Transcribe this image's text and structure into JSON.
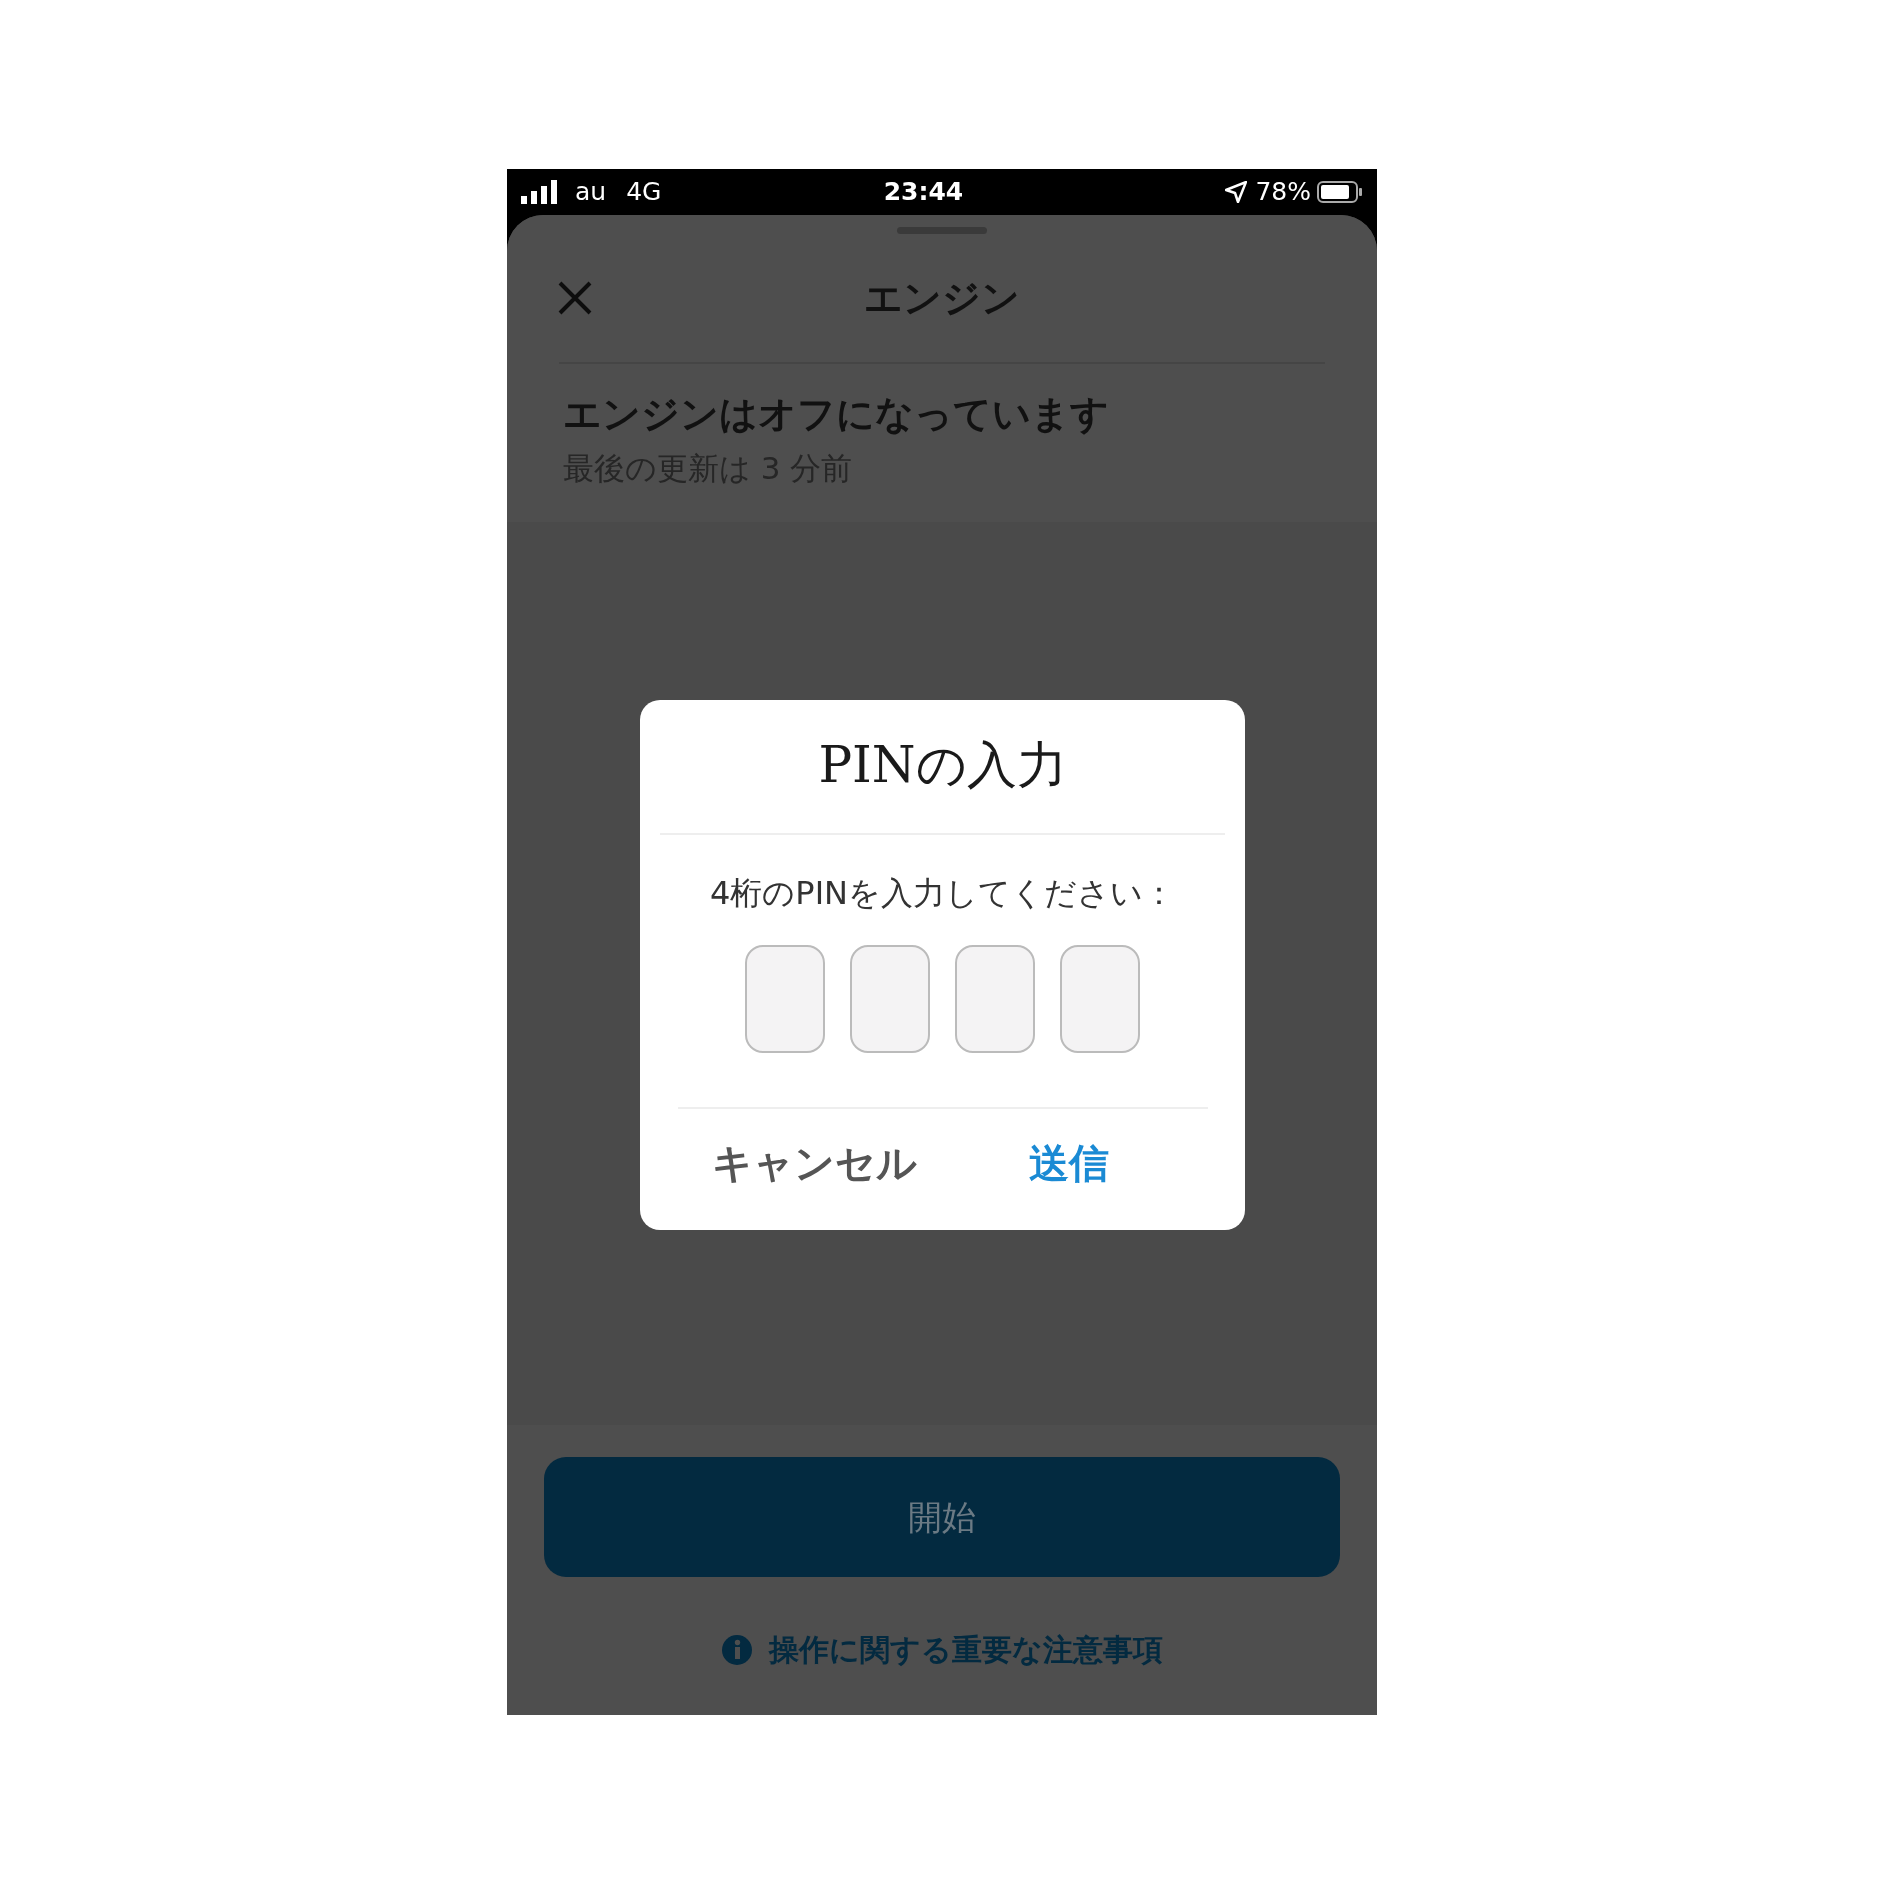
{
  "status_bar": {
    "carrier": "au",
    "network": "4G",
    "time": "23:44",
    "battery": "78%"
  },
  "sheet": {
    "title": "エンジン",
    "headline": "エンジンはオフになっています",
    "updated": "最後の更新は 3 分前"
  },
  "dialog": {
    "title": "PINの入力",
    "prompt": "4桁のPINを入力してください：",
    "pin_boxes": [
      {
        "filled": false
      },
      {
        "filled": false
      },
      {
        "filled": false
      },
      {
        "filled": false
      }
    ],
    "buttons": [
      {
        "label": "キャンセル",
        "kind": "cancel"
      },
      {
        "label": "送信",
        "kind": "primary"
      }
    ]
  },
  "start_button": {
    "label": "開始"
  },
  "notice_link": {
    "label": "操作に関する重要な注意事項"
  }
}
